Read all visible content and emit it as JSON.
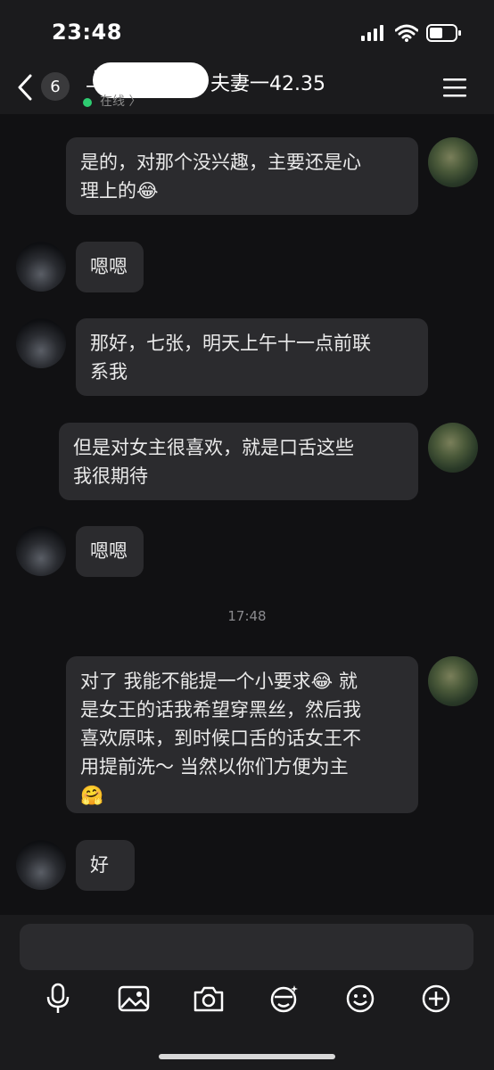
{
  "status_bar": {
    "time": "23:48"
  },
  "header": {
    "unread_count": "6",
    "name_prefix": "丄",
    "name_suffix": "夫妻一42.35",
    "online_status": "在线 〉"
  },
  "messages": [
    {
      "side": "right",
      "text_lines": [
        "是的，对那个没兴趣，主要还是心",
        "理上的😂"
      ]
    },
    {
      "side": "left",
      "text_lines": [
        "嗯嗯"
      ]
    },
    {
      "side": "left",
      "text_lines": [
        "那好，七张，明天上午十一点前联",
        "系我"
      ]
    },
    {
      "side": "right",
      "text_lines": [
        "但是对女主很喜欢，就是口舌这些",
        "我很期待"
      ]
    },
    {
      "side": "left",
      "text_lines": [
        "嗯嗯"
      ]
    },
    {
      "side": "right",
      "text_lines": [
        "对了 我能不能提一个小要求😂 就",
        "是女王的话我希望穿黑丝，然后我",
        "喜欢原味，到时候口舌的话女王不",
        "用提前洗～ 当然以你们方便为主",
        "🤗"
      ]
    },
    {
      "side": "left",
      "text_lines": [
        "好"
      ]
    }
  ],
  "timestamp": "17:48",
  "composer": {
    "placeholder": ""
  },
  "toolbar": [
    "microphone-icon",
    "image-icon",
    "camera-icon",
    "sticker-icon",
    "emoji-icon",
    "plus-icon"
  ],
  "colors": {
    "background": "#111113",
    "bubble": "#2b2b2e",
    "online": "#2ecc71"
  }
}
